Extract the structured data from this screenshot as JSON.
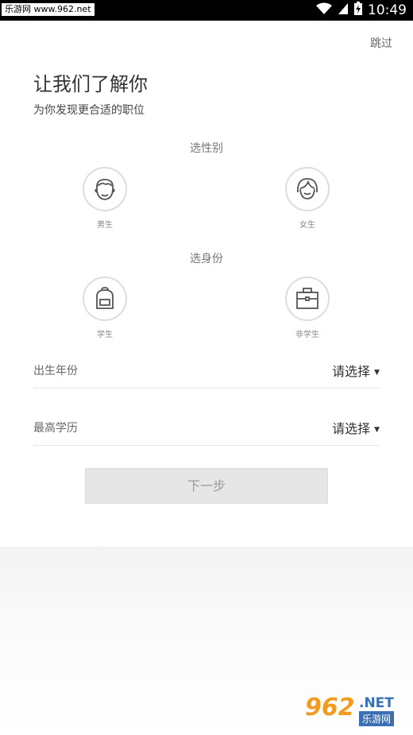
{
  "status_bar": {
    "watermark": "乐游网 www.962.net",
    "time": "10:49",
    "icons": [
      "wifi-icon",
      "signal-icon",
      "battery-charging-icon"
    ]
  },
  "header": {
    "skip_label": "跳过",
    "title": "让我们了解你",
    "subtitle": "为你发现更合适的职位"
  },
  "gender": {
    "section_label": "选性别",
    "options": [
      {
        "label": "男生",
        "icon": "male-face-icon"
      },
      {
        "label": "女生",
        "icon": "female-face-icon"
      }
    ]
  },
  "identity": {
    "section_label": "选身份",
    "options": [
      {
        "label": "学生",
        "icon": "backpack-icon"
      },
      {
        "label": "非学生",
        "icon": "briefcase-icon"
      }
    ]
  },
  "fields": [
    {
      "label": "出生年份",
      "value": "请选择"
    },
    {
      "label": "最高学历",
      "value": "请选择"
    }
  ],
  "next_button": {
    "label": "下一步"
  },
  "colors": {
    "disabled_button_bg": "#e6e6e6",
    "accent_logo_orange": "#f39a1f",
    "accent_logo_blue": "#3a6fb6"
  },
  "brand_watermark": {
    "number": "962",
    "suffix": ".NET",
    "cn": "乐游网"
  }
}
